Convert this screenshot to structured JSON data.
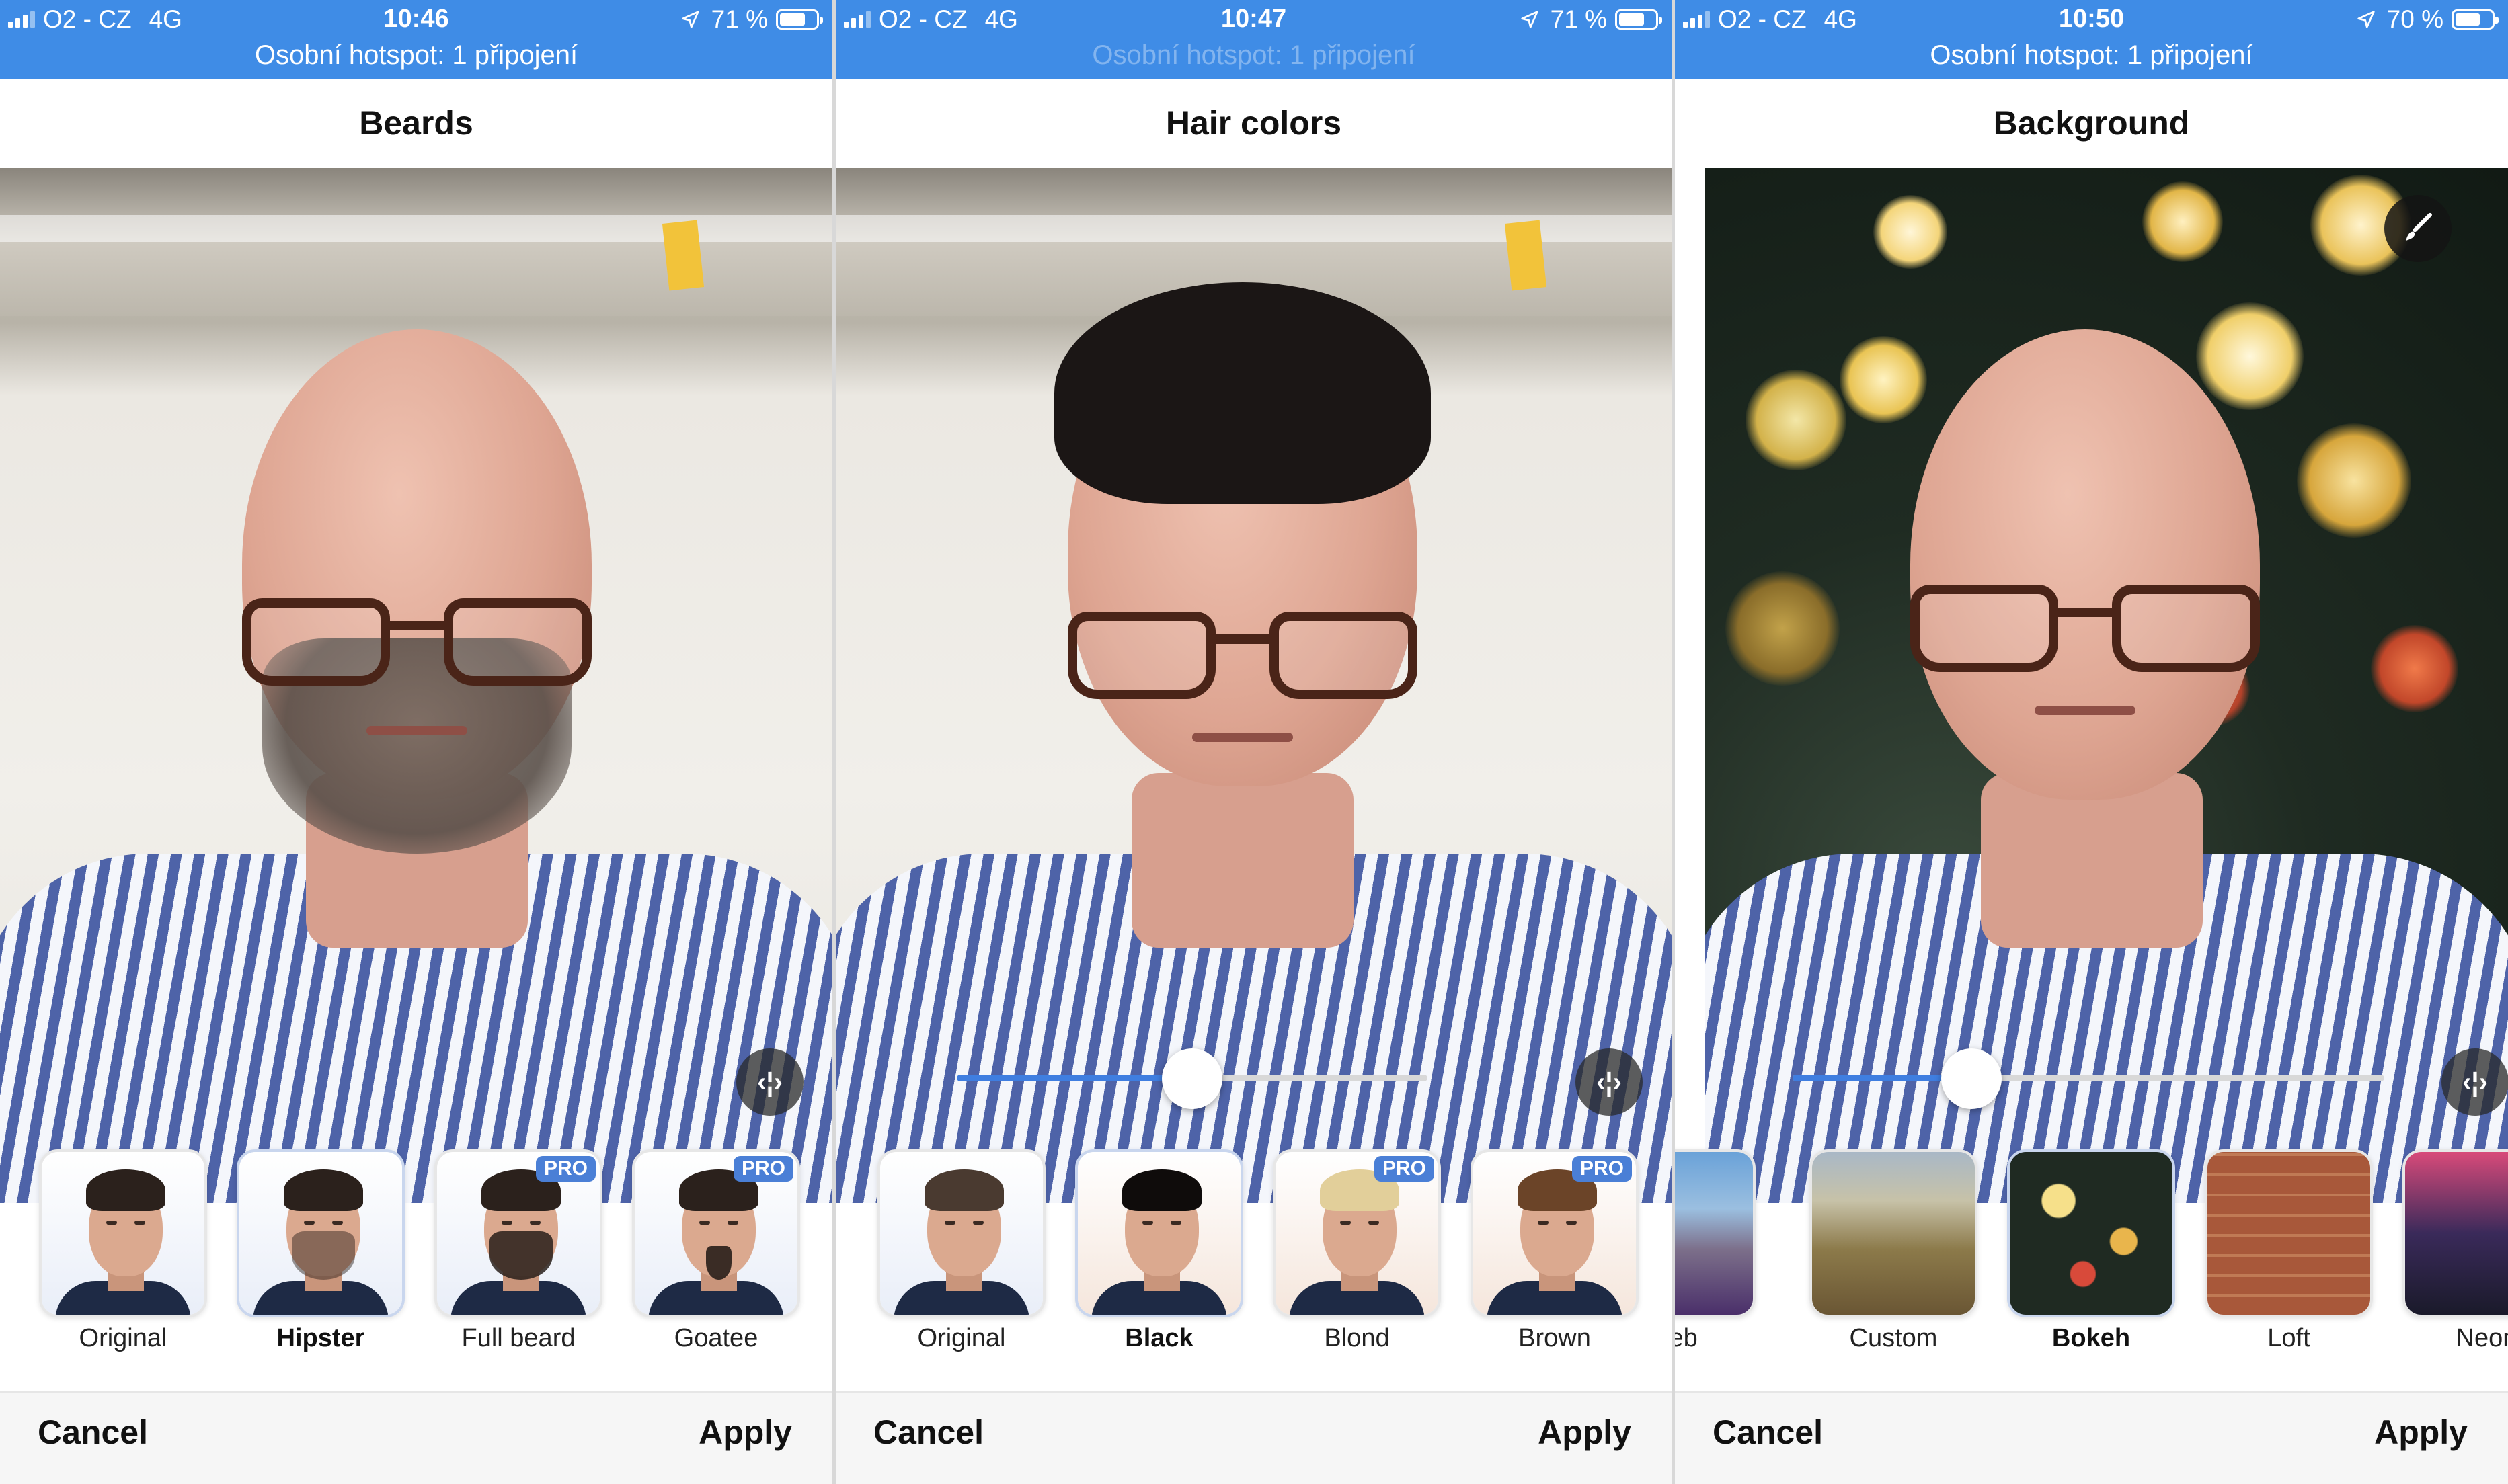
{
  "panels": [
    {
      "status": {
        "carrier": "O2 - CZ",
        "network": "4G",
        "time": "10:46",
        "battery": "71 %",
        "hotspot": "Osobní hotspot: 1 připojení"
      },
      "title": "Beards",
      "options": [
        {
          "label": "Original",
          "pro": ""
        },
        {
          "label": "Hipster",
          "pro": ""
        },
        {
          "label": "Full beard",
          "pro": "PRO"
        },
        {
          "label": "Goatee",
          "pro": "PRO"
        }
      ],
      "selected_option": "Hipster",
      "cancel_label": "Cancel",
      "apply_label": "Apply"
    },
    {
      "status": {
        "carrier": "O2 - CZ",
        "network": "4G",
        "time": "10:47",
        "battery": "71 %",
        "hotspot": "Osobní hotspot: 1 připojení"
      },
      "title": "Hair colors",
      "slider_value": 0.5,
      "options": [
        {
          "label": "Original",
          "pro": ""
        },
        {
          "label": "Black",
          "pro": ""
        },
        {
          "label": "Blond",
          "pro": "PRO"
        },
        {
          "label": "Brown",
          "pro": "PRO"
        }
      ],
      "selected_option": "Black",
      "cancel_label": "Cancel",
      "apply_label": "Apply"
    },
    {
      "status": {
        "carrier": "O2 - CZ",
        "network": "4G",
        "time": "10:50",
        "battery": "70 %",
        "hotspot": "Osobní hotspot: 1 připojení"
      },
      "title": "Background",
      "slider_value": 0.28,
      "options": [
        {
          "label": "Web",
          "pro": ""
        },
        {
          "label": "Custom",
          "pro": ""
        },
        {
          "label": "Bokeh",
          "pro": ""
        },
        {
          "label": "Loft",
          "pro": ""
        },
        {
          "label": "Neon",
          "pro": ""
        }
      ],
      "selected_option": "Bokeh",
      "cancel_label": "Cancel",
      "apply_label": "Apply"
    }
  ],
  "icons": {
    "compare": "split-compare-icon",
    "edit": "brush-icon",
    "location": "location-arrow-icon"
  },
  "colors": {
    "status_bar": "#3f8ce6",
    "accent": "#3f7ee0",
    "pro_badge": "#4a7fd6"
  }
}
